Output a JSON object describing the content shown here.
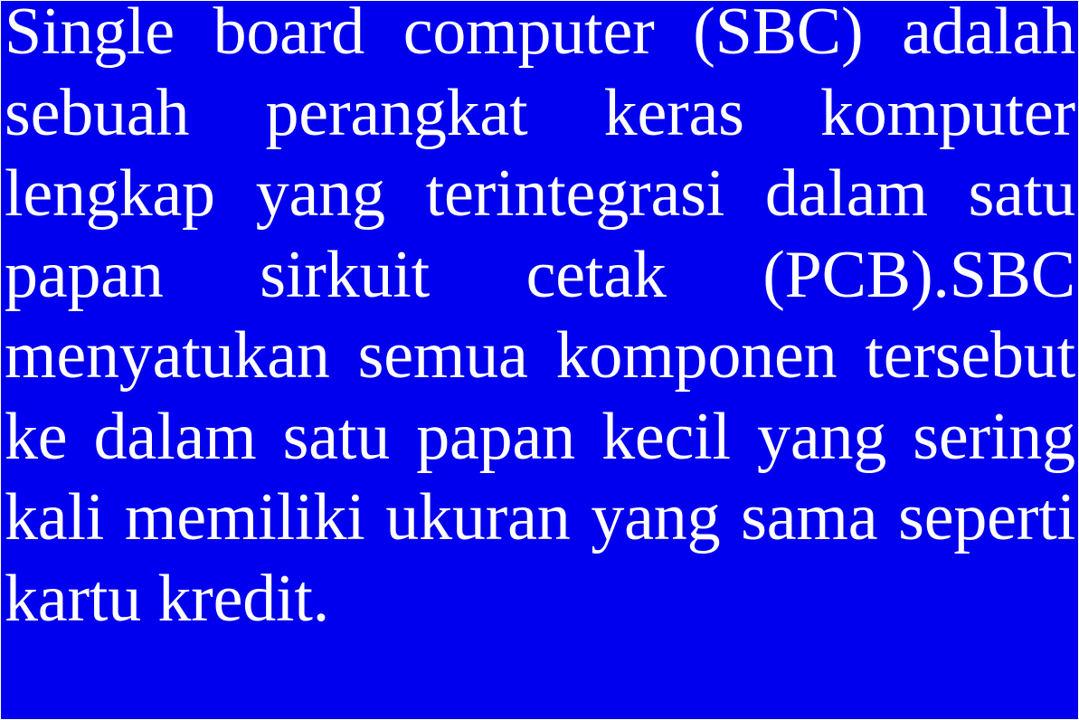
{
  "colors": {
    "background": "#0000ee",
    "text": "#ffffff"
  },
  "content": {
    "lines": [
      "Single board computer (SBC) adalah",
      "sebuah perangkat keras komputer",
      "lengkap yang terintegrasi dalam satu",
      "papan sirkuit cetak  (PCB).SBC",
      "menyatukan semua komponen tersebut",
      "ke dalam satu papan kecil yang sering",
      "kali memiliki ukuran yang sama seperti",
      "kartu kredit."
    ]
  }
}
